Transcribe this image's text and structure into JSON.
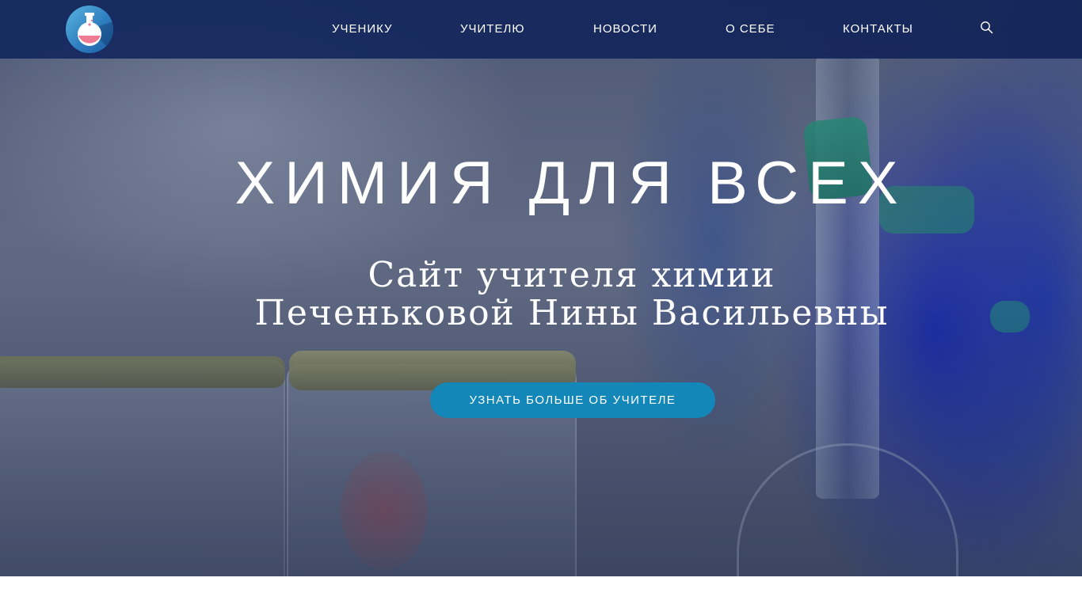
{
  "header": {
    "nav": [
      {
        "label": "УЧЕНИКУ"
      },
      {
        "label": "УЧИТЕЛЮ"
      },
      {
        "label": "НОВОСТИ"
      },
      {
        "label": "О СЕБЕ"
      },
      {
        "label": "КОНТАКТЫ"
      }
    ],
    "search_icon": "search-icon",
    "logo_icon": "chemistry-flask-logo"
  },
  "hero": {
    "title": "ХИМИЯ ДЛЯ ВСЕХ",
    "subtitle_line1": "Сайт учителя химии",
    "subtitle_line2": "Печеньковой Нины Васильевны",
    "cta_label": "УЗНАТЬ БОЛЬШЕ ОБ УЧИТЕЛЕ"
  },
  "colors": {
    "header_bg": "#15285d",
    "cta_bg": "#1387b8",
    "text": "#ffffff"
  }
}
